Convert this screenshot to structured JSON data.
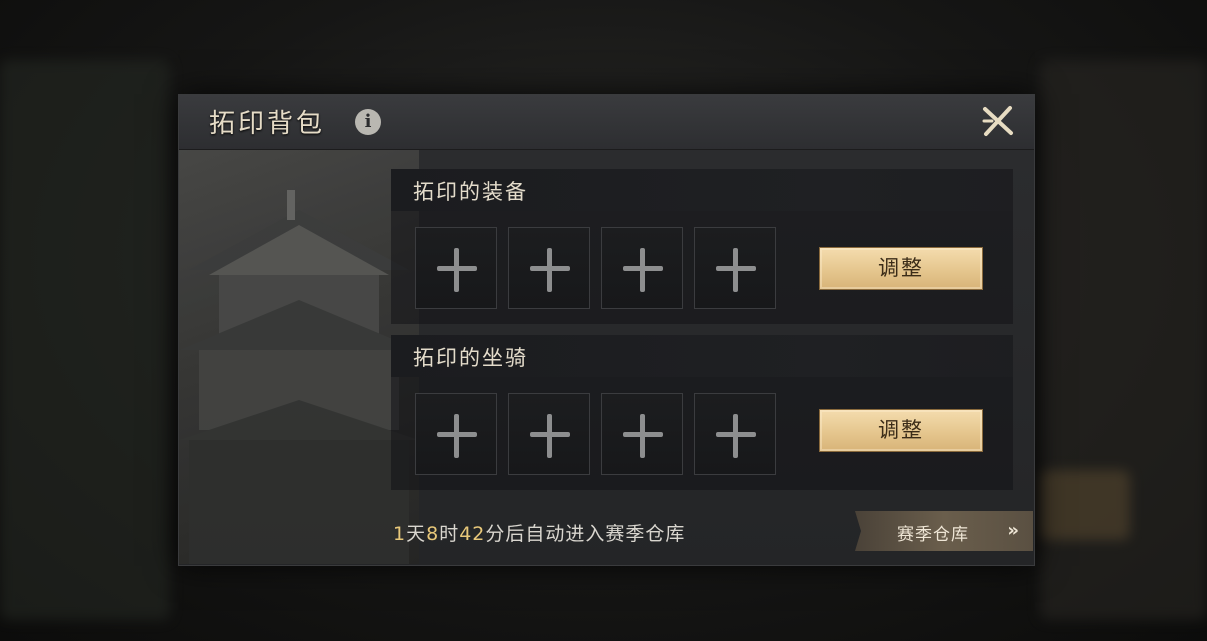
{
  "panel": {
    "title": "拓印背包",
    "info_icon": "info-icon",
    "close_icon": "close-icon"
  },
  "sections": [
    {
      "title": "拓印的装备",
      "slots": [
        "+",
        "+",
        "+",
        "+"
      ],
      "button_label": "调整"
    },
    {
      "title": "拓印的坐骑",
      "slots": [
        "+",
        "+",
        "+",
        "+"
      ],
      "button_label": "调整"
    }
  ],
  "footer": {
    "d_num": "1",
    "d_unit": "天",
    "h_num": "8",
    "h_unit": "时",
    "m_num": "42",
    "m_unit": "分",
    "suffix": "后自动进入赛季仓库",
    "warehouse_label": "赛季仓库",
    "warehouse_icon": "double-chevron-right-icon"
  },
  "colors": {
    "accent_gold": "#e8c87a",
    "button_gold": "#e5c68e",
    "panel_bg": "#2c2d2f"
  }
}
